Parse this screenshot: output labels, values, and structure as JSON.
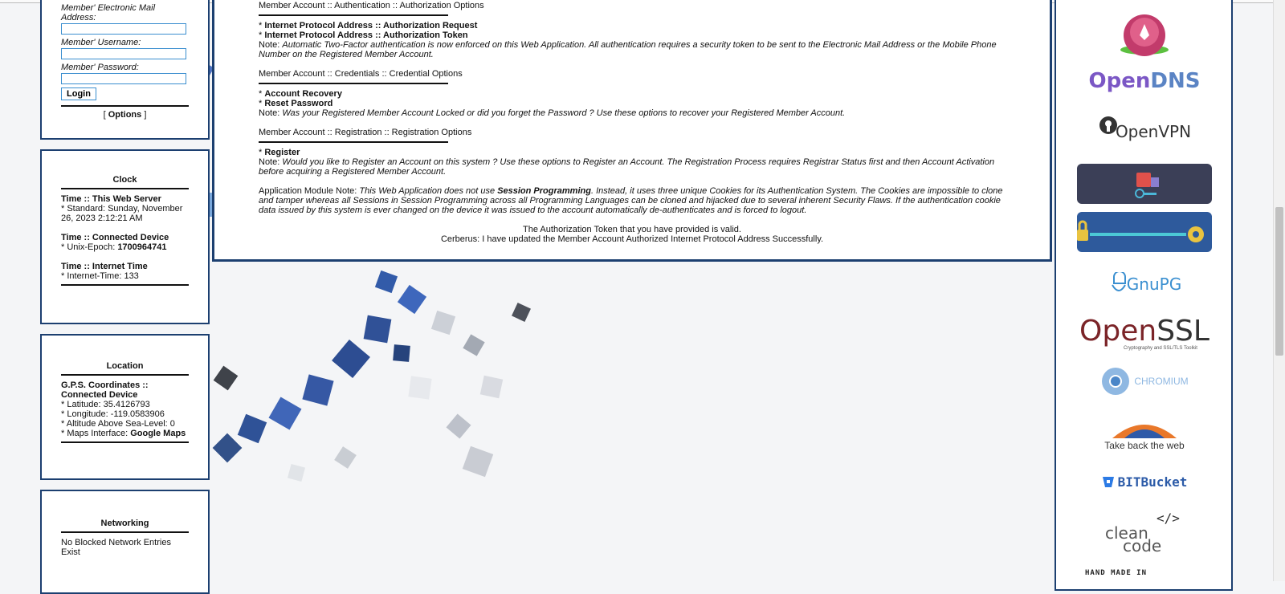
{
  "login": {
    "email_label": "Member' Electronic Mail Address:",
    "username_label": "Member' Username:",
    "password_label": "Member' Password:",
    "login_button": "Login",
    "options_open": "[ ",
    "options_link": "Options",
    "options_close": " ]"
  },
  "clock": {
    "title": "Clock",
    "server_heading": "Time :: This Web Server",
    "server_value": "* Standard: Sunday, November 26, 2023 2:12:21 AM",
    "device_heading": "Time :: Connected Device",
    "device_prefix": "* Unix-Epoch: ",
    "device_value": "1700964741",
    "internet_heading": "Time :: Internet Time",
    "internet_value": "* Internet-Time: 133"
  },
  "location": {
    "title": "Location",
    "heading": "G.P.S. Coordinates :: Connected Device",
    "latitude": "* Latitude: 35.4126793",
    "longitude": "* Longitude: -119.0583906",
    "altitude": "* Altitude Above Sea-Level: 0",
    "maps_prefix": "* Maps Interface: ",
    "maps_link": "Google Maps"
  },
  "networking": {
    "title": "Networking",
    "text": "No Blocked Network Entries Exist"
  },
  "main": {
    "auth_heading": "Member Account :: Authentication :: Authorization Options",
    "auth_item1": "Internet Protocol Address :: Authorization Request",
    "auth_item2": "Internet Protocol Address :: Authorization Token",
    "note_label": "Note: ",
    "auth_note": "Automatic Two-Factor authentication is now enforced on this Web Application. All authentication requires a security token to be sent to the Electronic Mail Address or the Mobile Phone Number on the Registered Member Account.",
    "cred_heading": "Member Account :: Credentials :: Credential Options",
    "cred_item1": "Account Recovery",
    "cred_item2": "Reset Password",
    "cred_note": "Was your Registered Member Account Locked or did you forget the Password ? Use these options to recover your Registered Member Account.",
    "reg_heading": "Member Account :: Registration :: Registration Options",
    "reg_item1": "Register",
    "reg_note": "Would you like to Register an Account on this system ? Use these options to Register an Account. The Registration Process requires Registrar Status first and then Account Activation before acquiring a Registered Member Account.",
    "module_label": "Application Module Note: ",
    "module_note_a": "This Web Application does not use ",
    "module_bold": "Session Programming",
    "module_note_b": ". Instead, it uses three unique Cookies for its Authentication System. The Cookies are impossible to clone and tamper whereas all Sessions in Session Programming across all Programming Languages can be cloned and hijacked due to several inherent Security Flaws. If the authentication cookie data issued by this system is ever changed on the device it was issued to the account automatically de-authenticates and is forced to logout.",
    "status1": "The Authorization Token that you have provided is valid.",
    "status2": "Cerberus: I have updated the Member Account Authorized Internet Protocol Address Successfully."
  },
  "logos": {
    "opendns_open": "Open",
    "opendns_dns": "DNS",
    "openvpn": "OpenVPN",
    "gnupg": "GnuPG",
    "openssl_open": "Open",
    "openssl_ssl": "SSL",
    "openssl_tag": "Cryptography and SSL/TLS Toolkit",
    "chromium": "CHROMIUM",
    "firefox": "Take back the web",
    "bitbucket": "BITBucket",
    "cleancode_clean": "clean",
    "cleancode_code": "code",
    "handmade": "HAND MADE IN"
  }
}
